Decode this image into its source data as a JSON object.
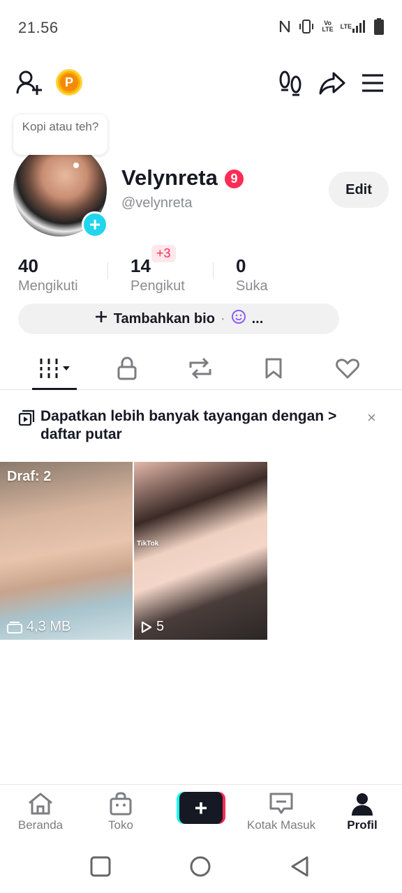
{
  "status_bar": {
    "time": "21.56",
    "signal_text_top": "Vo",
    "signal_text_bottom": "LTE",
    "lte_label": "LTE"
  },
  "top_bar": {
    "coin_label": "P"
  },
  "profile": {
    "note_bubble": "Kopi atau teh?",
    "display_name": "Velynreta",
    "name_badge": "9",
    "username": "@velynreta",
    "edit_label": "Edit"
  },
  "stats": {
    "following_count": "40",
    "following_label": "Mengikuti",
    "followers_count": "14",
    "followers_label": "Pengikut",
    "followers_new": "+3",
    "likes_count": "0",
    "likes_label": "Suka"
  },
  "bio": {
    "add_label": "Tambahkan bio",
    "separator": "·",
    "more": "..."
  },
  "banner": {
    "text": "Dapatkan lebih banyak tayangan dengan > daftar putar",
    "close": "×"
  },
  "videos": [
    {
      "top_label": "Draf: 2",
      "bottom_label": "4,3 MB"
    },
    {
      "bottom_label": "5",
      "watermark": "TikTok"
    }
  ],
  "bottom_nav": {
    "home": "Beranda",
    "shop": "Toko",
    "create": "+",
    "inbox": "Kotak Masuk",
    "profile": "Profil"
  },
  "colors": {
    "accent_red": "#fe2c55",
    "accent_cyan": "#20d5ec",
    "text_primary": "#161823",
    "text_secondary": "#8a8b91"
  }
}
